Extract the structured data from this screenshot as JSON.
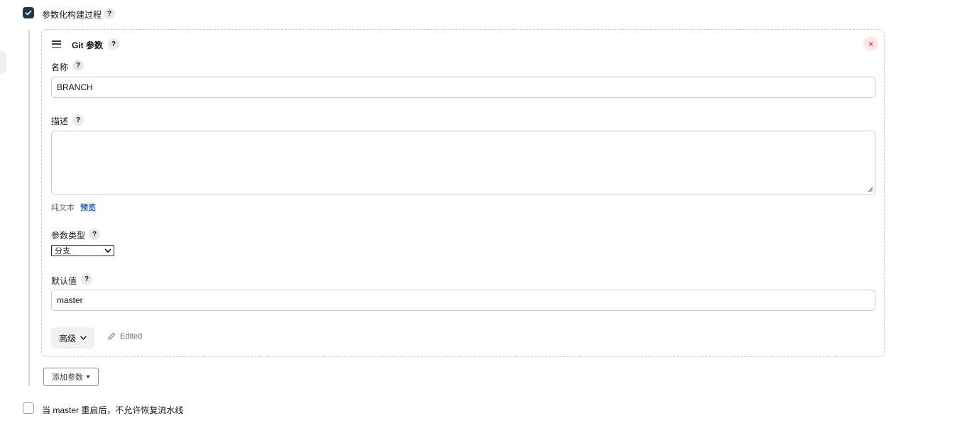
{
  "parameterized": {
    "label": "参数化构建过程",
    "checked": true,
    "help": "?"
  },
  "git_param": {
    "title": "Git 参数",
    "help": "?",
    "close_symbol": "×",
    "name": {
      "label": "名称",
      "help": "?",
      "value": "BRANCH"
    },
    "description": {
      "label": "描述",
      "help": "?",
      "value": "",
      "plain_text_label": "纯文本",
      "preview_label": "预览"
    },
    "param_type": {
      "label": "参数类型",
      "help": "?",
      "selected": "分支"
    },
    "default_value": {
      "label": "默认值",
      "help": "?",
      "value": "master"
    },
    "advanced_label": "高级",
    "edited_label": "Edited"
  },
  "add_param_label": "添加参数",
  "no_resume": {
    "label": "当 master 重启后，不允许恢复流水线",
    "checked": false
  },
  "colors": {
    "checkbox_checked": "#20364c",
    "close_red": "#d6213a",
    "close_bg": "#fde8ea",
    "link_blue": "#2a5db0"
  },
  "icons": [
    "check-icon",
    "help-icon",
    "drag-handle-icon",
    "close-icon",
    "resize-grip-icon",
    "chevron-down-icon",
    "pencil-icon",
    "caret-down-icon"
  ]
}
